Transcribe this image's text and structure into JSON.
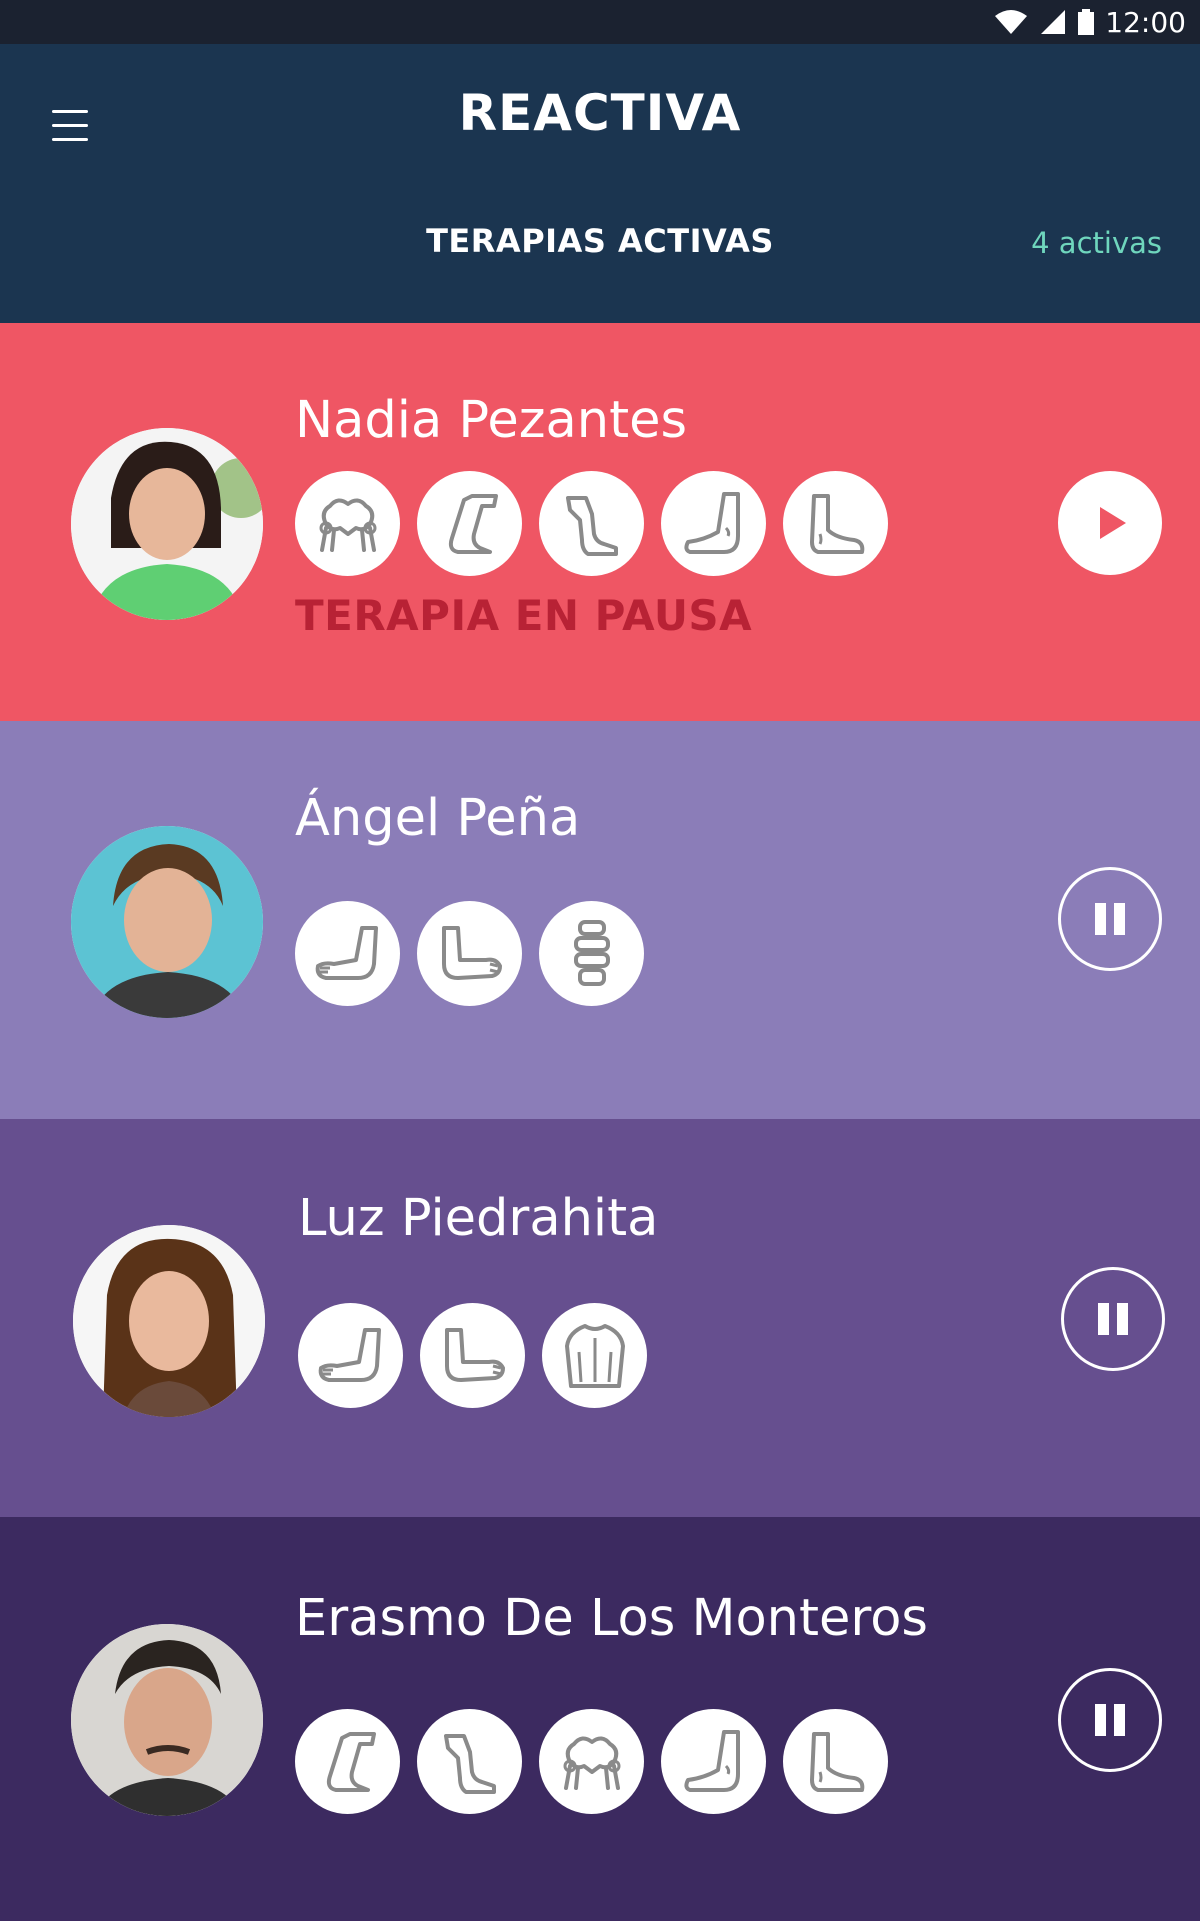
{
  "status_bar": {
    "time": "12:00",
    "icons": [
      "wifi-icon",
      "signal-icon",
      "battery-icon"
    ]
  },
  "header": {
    "menu_icon": "hamburger-menu-icon",
    "logo_text": "REACTIVA",
    "section_title": "TERAPIAS ACTIVAS",
    "active_count": "4 activas"
  },
  "colors": {
    "header_bg": "#1b3550",
    "accent_count": "#6fd6bd",
    "card_1": "#ef5664",
    "card_2": "#8b7db8",
    "card_3": "#664f8f",
    "card_4": "#3c2a60",
    "paused_text": "#b82235"
  },
  "patients": [
    {
      "name": "Nadia Pezantes",
      "therapies": [
        "hip-icon",
        "knee-bent-icon",
        "knee-straight-icon",
        "ankle-icon",
        "foot-icon"
      ],
      "status": "TERAPIA EN PAUSA",
      "action": "play-icon"
    },
    {
      "name": "Ángel Peña",
      "therapies": [
        "elbow-icon",
        "arm-icon",
        "spine-icon"
      ],
      "status": "",
      "action": "pause-icon"
    },
    {
      "name": "Luz Piedrahita",
      "therapies": [
        "elbow-icon",
        "arm-icon",
        "back-icon"
      ],
      "status": "",
      "action": "pause-icon"
    },
    {
      "name": "Erasmo De Los Monteros",
      "therapies": [
        "knee-bent-icon",
        "knee-straight-icon",
        "hip-icon",
        "ankle-icon",
        "foot-icon"
      ],
      "status": "",
      "action": "pause-icon"
    }
  ]
}
